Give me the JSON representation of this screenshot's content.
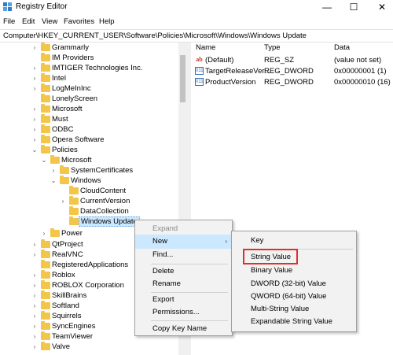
{
  "window": {
    "title": "Registry Editor",
    "minimize_glyph": "—",
    "maximize_glyph": "☐",
    "close_glyph": "✕",
    "icon": "registry-editor-icon"
  },
  "menu": [
    "File",
    "Edit",
    "View",
    "Favorites",
    "Help"
  ],
  "address": "Computer\\HKEY_CURRENT_USER\\Software\\Policies\\Microsoft\\Windows\\Windows Update",
  "tree": [
    {
      "label": "Grammarly",
      "chevron": "›"
    },
    {
      "label": "IM Providers",
      "chevron": ""
    },
    {
      "label": "IMTIGER Technologies Inc.",
      "chevron": "›"
    },
    {
      "label": "Intel",
      "chevron": "›"
    },
    {
      "label": "LogMeInInc",
      "chevron": "›"
    },
    {
      "label": "LonelyScreen",
      "chevron": ""
    },
    {
      "label": "Microsoft",
      "chevron": "›"
    },
    {
      "label": "Must",
      "chevron": "›"
    },
    {
      "label": "ODBC",
      "chevron": "›"
    },
    {
      "label": "Opera Software",
      "chevron": "›"
    },
    {
      "label": "Policies",
      "chevron": "⌄"
    },
    {
      "label": "Microsoft",
      "chevron": "⌄"
    },
    {
      "label": "SystemCertificates",
      "chevron": "›"
    },
    {
      "label": "Windows",
      "chevron": "⌄"
    },
    {
      "label": "CloudContent",
      "chevron": ""
    },
    {
      "label": "CurrentVersion",
      "chevron": "›"
    },
    {
      "label": "DataCollection",
      "chevron": ""
    },
    {
      "label": "Windows Update",
      "chevron": ""
    },
    {
      "label": "Power",
      "chevron": "›"
    },
    {
      "label": "QtProject",
      "chevron": "›"
    },
    {
      "label": "RealVNC",
      "chevron": "›"
    },
    {
      "label": "RegisteredApplications",
      "chevron": ""
    },
    {
      "label": "Roblox",
      "chevron": "›"
    },
    {
      "label": "ROBLOX Corporation",
      "chevron": "›"
    },
    {
      "label": "SkillBrains",
      "chevron": "›"
    },
    {
      "label": "Softland",
      "chevron": "›"
    },
    {
      "label": "Squirrels",
      "chevron": "›"
    },
    {
      "label": "SyncEngines",
      "chevron": "›"
    },
    {
      "label": "TeamViewer",
      "chevron": "›"
    },
    {
      "label": "Valve",
      "chevron": "›"
    }
  ],
  "list": {
    "headers": [
      "Name",
      "Type",
      "Data"
    ],
    "rows": [
      {
        "icon": "ab",
        "name": "(Default)",
        "type": "REG_SZ",
        "data": "(value not set)"
      },
      {
        "icon": "011",
        "name": "TargetReleaseVer...",
        "type": "REG_DWORD",
        "data": "0x00000001 (1)"
      },
      {
        "icon": "011",
        "name": "ProductVersion",
        "type": "REG_DWORD",
        "data": "0x00000010 (16)"
      }
    ]
  },
  "context_menu": {
    "items": [
      "Expand",
      "New",
      "Find...",
      "Delete",
      "Rename",
      "Export",
      "Permissions...",
      "Copy Key Name"
    ],
    "submenu_arrow": "›"
  },
  "new_submenu": {
    "items": [
      "Key",
      "String Value",
      "Binary Value",
      "DWORD (32-bit) Value",
      "QWORD (64-bit) Value",
      "Multi-String Value",
      "Expandable String Value"
    ]
  },
  "colors": {
    "selection": "#cce8ff",
    "highlight_box": "#e0302a",
    "folder": "#f3c64b"
  }
}
